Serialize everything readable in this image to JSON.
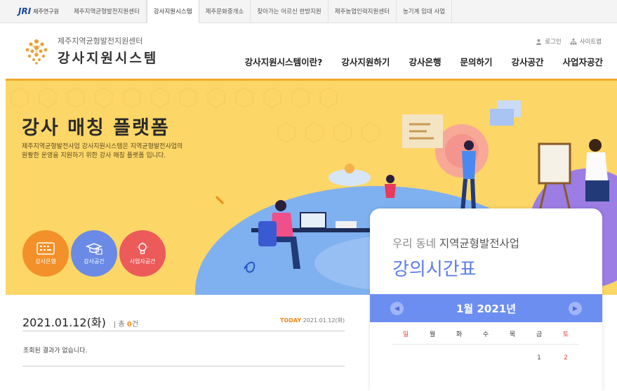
{
  "site_tabs": {
    "logo_mark": "JRI",
    "logo_text": "제주연구원",
    "items": [
      "제주지역균형발전지원센터",
      "강사지원시스템",
      "제주문화중개소",
      "찾아가는 어르신 한방지원",
      "제주농업인력지원센터",
      "농기계 임대 사업"
    ]
  },
  "header": {
    "logo_sub": "제주지역균형발전지원센터",
    "logo_main": "강사지원시스템",
    "login": "로그인",
    "sitemap": "사이트맵",
    "nav": [
      "강사지원시스템이란?",
      "강사지원하기",
      "강사은행",
      "문의하기",
      "강사공간",
      "사업자공간"
    ]
  },
  "hero": {
    "title": "강사 매칭 플랫폼",
    "desc_line1": "제주지역균형발전사업 강사지원시스템은 지역균형발전사업의",
    "desc_line2": "원활한 운영을 지원하기 위한 강사 매칭 플랫폼 입니다.",
    "quick": [
      "강사은행",
      "강사공간",
      "사업자공간"
    ]
  },
  "calendar": {
    "subtitle_pre": "우리 동네",
    "subtitle_post": "지역균형발전사업",
    "title": "강의시간표",
    "month": "1월",
    "year": "2021년",
    "weekdays": [
      "일",
      "월",
      "화",
      "수",
      "목",
      "금",
      "토"
    ],
    "first_row": [
      "",
      "",
      "",
      "",
      "",
      "1",
      "2"
    ]
  },
  "list": {
    "date": "2021.01.12(화)",
    "count_label": "총",
    "count": "0",
    "count_unit": "건",
    "today_label": "TODAY",
    "today_date": "2021.01.12(화)",
    "empty_message": "조회된 결과가 없습니다."
  },
  "colors": {
    "hero_bg": "#fcd667",
    "accent_blue": "#6d8ef1",
    "accent_orange": "#f08a19"
  }
}
